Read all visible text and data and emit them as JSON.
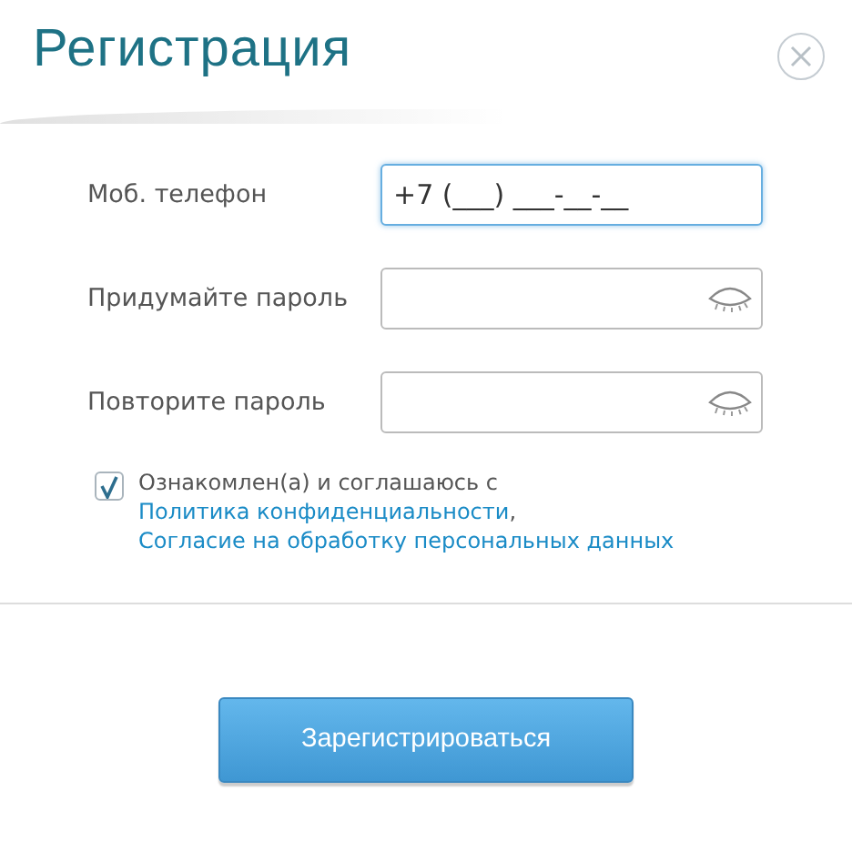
{
  "dialog": {
    "title": "Регистрация"
  },
  "fields": [
    {
      "label": "Моб. телефон",
      "kind": "phone",
      "value": "+7 (___) ___-__-__",
      "focused": true
    },
    {
      "label": "Придумайте пароль",
      "kind": "password",
      "focused": false
    },
    {
      "label": "Повторите пароль",
      "kind": "password",
      "focused": false
    }
  ],
  "consent": {
    "checked": true,
    "parts": [
      {
        "kind": "text",
        "text": "Ознакомлен(а) и соглашаюсь с"
      },
      {
        "kind": "link",
        "text": "Политика конфиденциальности"
      },
      {
        "kind": "text",
        "text": ","
      },
      {
        "kind": "link",
        "text": "Согласие на обработку персональных данных"
      }
    ]
  },
  "submit": {
    "label": "Зарегистрироваться"
  }
}
